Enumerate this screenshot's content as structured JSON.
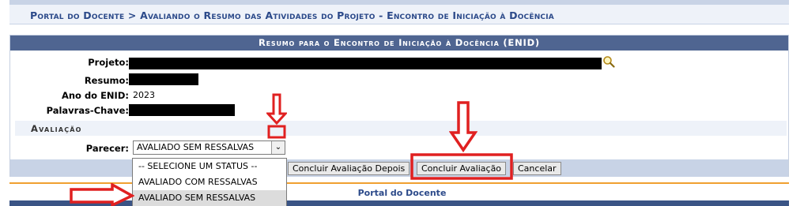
{
  "breadcrumb": {
    "text": "Portal do Docente > Avaliando o Resumo das Atividades do Projeto - Encontro de Iniciação à Docência"
  },
  "form": {
    "caption": "Resumo para o Encontro de Iniciação à Docência (ENID)",
    "fields": {
      "projeto_label": "Projeto:",
      "resumo_label": "Resumo:",
      "ano_label": "Ano do ENID:",
      "ano_value": "2023",
      "palavras_label": "Palavras-Chave:"
    },
    "section_title": "Avaliação",
    "parecer_label": "Parecer:",
    "parecer_selected": "AVALIADO SEM RESSALVAS",
    "dropdown_options": [
      "-- SELECIONE UM STATUS --",
      "AVALIADO COM RESSALVAS",
      "AVALIADO SEM RESSALVAS"
    ],
    "buttons": {
      "concluir_depois": "Concluir Avaliação Depois",
      "concluir": "Concluir Avaliação",
      "cancelar": "Cancelar"
    }
  },
  "footer": {
    "link": "Portal do Docente"
  },
  "icons": {
    "search": "magnifier-icon",
    "select_arrow": "chevron-down-icon"
  },
  "colors": {
    "caption_bg": "#4f6591",
    "accent_text": "#2c4a8a",
    "annotation_red": "#e02020"
  }
}
